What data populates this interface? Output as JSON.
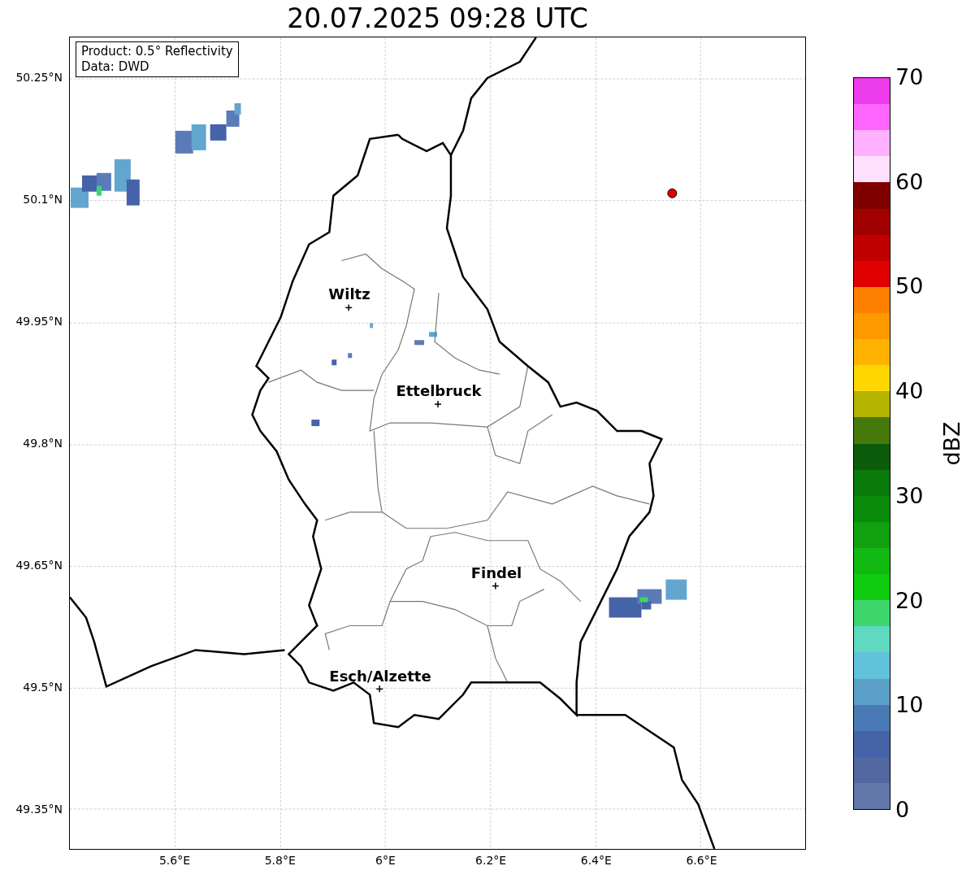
{
  "title": "20.07.2025 09:28 UTC",
  "map": {
    "info_box": [
      "Product: 0.5° Reflectivity",
      "Data: DWD"
    ],
    "cities": [
      {
        "name": "Wiltz"
      },
      {
        "name": "Ettelbruck"
      },
      {
        "name": "Findel"
      },
      {
        "name": "Esch/Alzette"
      }
    ],
    "yticks": [
      "50.25°N",
      "50.1°N",
      "49.95°N",
      "49.8°N",
      "49.65°N",
      "49.5°N",
      "49.35°N"
    ],
    "xticks": [
      "5.6°E",
      "5.8°E",
      "6°E",
      "6.2°E",
      "6.4°E",
      "6.6°E"
    ]
  },
  "colorbar": {
    "label": "dBZ",
    "ticks": [
      "70",
      "60",
      "50",
      "40",
      "30",
      "20",
      "10",
      "0"
    ],
    "segments": [
      {
        "color": "#ec3cec"
      },
      {
        "color": "#ff66ff"
      },
      {
        "color": "#ffb0ff"
      },
      {
        "color": "#ffe0ff"
      },
      {
        "color": "#800000"
      },
      {
        "color": "#a00000"
      },
      {
        "color": "#c00000"
      },
      {
        "color": "#e00000"
      },
      {
        "color": "#ff8000"
      },
      {
        "color": "#ff9900"
      },
      {
        "color": "#ffb300"
      },
      {
        "color": "#ffd700"
      },
      {
        "color": "#b3b300"
      },
      {
        "color": "#457a0a"
      },
      {
        "color": "#0a5c0a"
      },
      {
        "color": "#0a7a0a"
      },
      {
        "color": "#0a8c0a"
      },
      {
        "color": "#10a010"
      },
      {
        "color": "#12b812"
      },
      {
        "color": "#10cc10"
      },
      {
        "color": "#3cd66a"
      },
      {
        "color": "#5fd9c0"
      },
      {
        "color": "#62c2dc"
      },
      {
        "color": "#5ba0c8"
      },
      {
        "color": "#4a7ab5"
      },
      {
        "color": "#4463a8"
      },
      {
        "color": "#52679f"
      },
      {
        "color": "#6378aa"
      }
    ]
  }
}
